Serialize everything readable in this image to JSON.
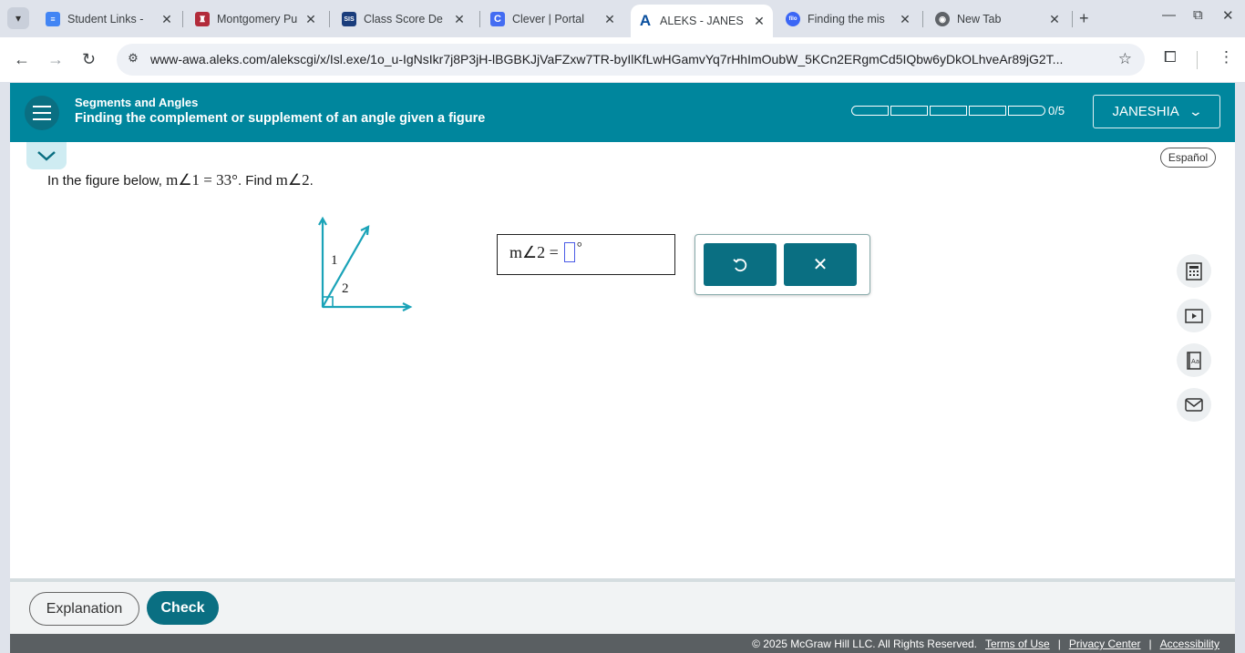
{
  "browser": {
    "tabs": [
      {
        "title": "Student Links - ",
        "icon": "docs-icon",
        "color": "#4285f4"
      },
      {
        "title": "Montgomery Pu",
        "icon": "school-icon",
        "color": "#b22b3a"
      },
      {
        "title": "Class Score De",
        "icon": "sis-icon",
        "color": "#1a3d7c",
        "icon_text": "SIS"
      },
      {
        "title": "Clever | Portal",
        "icon": "clever-icon",
        "color": "#436cf2",
        "icon_text": "C"
      },
      {
        "title": "ALEKS - JANES",
        "icon": "aleks-icon",
        "color": "#0a4f9e",
        "icon_text": "A",
        "active": true
      },
      {
        "title": "Finding the mis",
        "icon": "filo-icon",
        "color": "#3b66f5",
        "icon_text": "filo"
      },
      {
        "title": "New Tab",
        "icon": "chrome-icon",
        "color": "#5f6368"
      }
    ],
    "url": "www-awa.aleks.com/alekscgi/x/Isl.exe/1o_u-IgNsIkr7j8P3jH-lBGBKJjVaFZxw7TR-byIlKfLwHGamvYq7rHhImOubW_5KCn2ERgmCd5IQbw6yDkOLhveAr89jG2T..."
  },
  "header": {
    "topic": "Segments and Angles",
    "subtopic": "Finding the complement or supplement of an angle given a figure",
    "progress_text": "0/5",
    "progress_filled": 0,
    "progress_total": 5,
    "user": "JANESHIA"
  },
  "language_button": "Español",
  "question": {
    "prefix": "In the figure below, ",
    "given": "m∠1 = 33°",
    "middle": ". Find ",
    "find": "m∠2",
    "suffix": "."
  },
  "figure": {
    "label1": "1",
    "label2": "2",
    "color": "#1aa3b8"
  },
  "answer": {
    "expr": "m∠2 =",
    "value": "",
    "unit": "°"
  },
  "tools": {
    "undo_icon": "undo-icon",
    "clear_icon": "close-icon"
  },
  "bottom": {
    "explanation": "Explanation",
    "check": "Check"
  },
  "footer": {
    "copyright": "© 2025 McGraw Hill LLC. All Rights Reserved.",
    "terms": "Terms of Use",
    "sep": "|",
    "privacy": "Privacy Center",
    "accessibility": "Accessibility"
  },
  "colors": {
    "accent": "#00869d",
    "button": "#0a6f82"
  }
}
